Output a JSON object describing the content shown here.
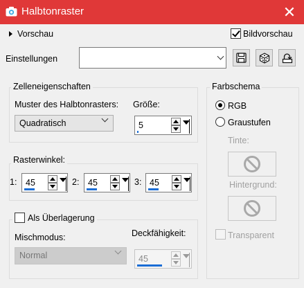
{
  "window": {
    "title": "Halbtonraster",
    "close_glyph": "✕"
  },
  "preview": {
    "toggle_label": "Vorschau",
    "bildvorschau_label": "Bildvorschau",
    "bildvorschau_checked": true
  },
  "einstellungen": {
    "label": "Einstellungen",
    "preset_value": "",
    "buttons": [
      "save-icon",
      "random-dice-icon",
      "reset-defaults-icon"
    ]
  },
  "zelleneigenschaften": {
    "title": "Zelleneigenschaften",
    "muster_label": "Muster des Halbtonrasters:",
    "muster_value": "Quadratisch",
    "groesse_label": "Größe:",
    "groesse_value": "5",
    "groesse_fraction": 0.02
  },
  "rasterwinkel": {
    "title": "Rasterwinkel:",
    "channels": [
      {
        "label": "1:",
        "value": "45",
        "fraction": 0.125
      },
      {
        "label": "2:",
        "value": "45",
        "fraction": 0.125
      },
      {
        "label": "3:",
        "value": "45",
        "fraction": 0.125
      }
    ]
  },
  "ueberlagerung": {
    "label": "Als Überlagerung",
    "checked": false,
    "mischmodus_label": "Mischmodus:",
    "mischmodus_value": "Normal",
    "deckfaehigkeit_label": "Deckfähigkeit:",
    "deckfaehigkeit_value": "45",
    "deckfaehigkeit_fraction": 0.45
  },
  "farbschema": {
    "title": "Farbschema",
    "rgb_label": "RGB",
    "graustufen_label": "Graustufen",
    "selected": "RGB",
    "tinte_label": "Tinte:",
    "hintergrund_label": "Hintergrund:",
    "transparent_label": "Transparent",
    "transparent_checked": false
  },
  "colors": {
    "titlebar": "#e03838",
    "accent_bar": "#1a6dd5"
  }
}
